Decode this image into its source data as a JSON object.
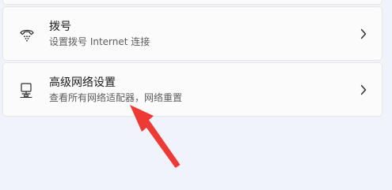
{
  "settings": {
    "items": [
      {
        "id": "dialup",
        "icon": "dialup-phone-icon",
        "title": "拨号",
        "subtitle": "设置拨号 Internet 连接"
      },
      {
        "id": "advanced-network",
        "icon": "computer-network-icon",
        "title": "高级网络设置",
        "subtitle": "查看所有网络适配器，网络重置"
      }
    ]
  },
  "colors": {
    "background": "#f0f3f9",
    "card": "#fbfbfb",
    "annotation_arrow": "#ee3a35"
  }
}
